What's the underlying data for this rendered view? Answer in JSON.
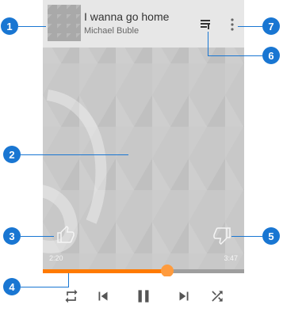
{
  "now_playing": {
    "title": "I wanna go home",
    "artist": "Michael Buble"
  },
  "playback": {
    "elapsed": "2:20",
    "duration": "3:47",
    "progress": 0.62
  },
  "callouts": [
    "1",
    "2",
    "3",
    "4",
    "5",
    "6",
    "7"
  ],
  "colors": {
    "accent": "#ff7a00",
    "callout": "#1976d2"
  },
  "icons": [
    "queue-icon",
    "more-vert-icon",
    "thumb-up-icon",
    "thumb-down-icon",
    "repeat-icon",
    "skip-previous-icon",
    "pause-icon",
    "skip-next-icon",
    "shuffle-icon"
  ]
}
